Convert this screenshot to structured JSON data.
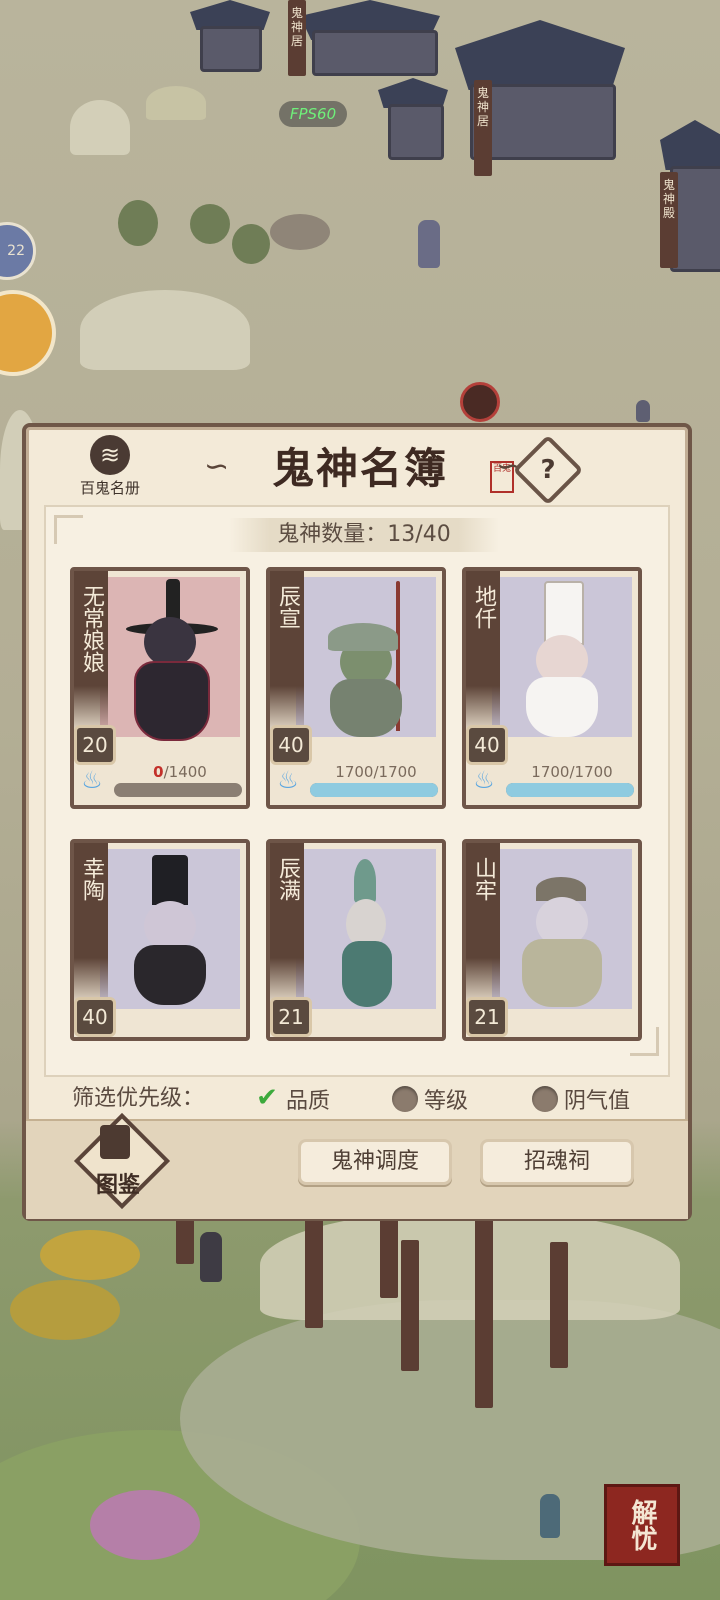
{
  "hud": {
    "fps": "FPS60",
    "side_badge": "22",
    "fix_button_label": "解忧"
  },
  "map_banners": [
    "鬼神居",
    "鬼神居",
    "鬼神殿"
  ],
  "dialog": {
    "title": "鬼神名簿",
    "seal_text": "百鬼",
    "help_icon": "question-mark",
    "book_label": "百鬼名册",
    "count_label": "鬼神数量：13/40",
    "cards": [
      {
        "name": "无常娘娘",
        "level": "20",
        "hp_current": "0",
        "hp_sep": "/",
        "hp_max": "1400",
        "hp_fraction": 0.0,
        "art": "pink"
      },
      {
        "name": "辰宣",
        "level": "40",
        "hp_current": "1700",
        "hp_sep": "/",
        "hp_max": "1700",
        "hp_fraction": 1.0,
        "art": "lilac"
      },
      {
        "name": "地仟",
        "level": "40",
        "hp_current": "1700",
        "hp_sep": "/",
        "hp_max": "1700",
        "hp_fraction": 1.0,
        "art": "lilac"
      },
      {
        "name": "幸陶",
        "level": "40",
        "art": "lilac"
      },
      {
        "name": "辰满",
        "level": "21",
        "art": "lilac"
      },
      {
        "name": "山牢",
        "level": "21",
        "art": "lilac"
      }
    ],
    "filter": {
      "label": "筛选优先级：",
      "options": [
        {
          "label": "品质",
          "selected": true
        },
        {
          "label": "等级",
          "selected": false
        },
        {
          "label": "阴气值",
          "selected": false
        }
      ]
    },
    "footer": {
      "atlas_label": "图鉴",
      "dispatch_label": "鬼神调度",
      "shrine_label": "招魂祠"
    }
  },
  "colors": {
    "panel_bg": "#f3ead8",
    "panel_border": "#6f5748",
    "hp_fill": "#8fcbe0",
    "hp_empty": "#8a7e73",
    "danger_text": "#c3302a",
    "check_green": "#3caa3c"
  }
}
